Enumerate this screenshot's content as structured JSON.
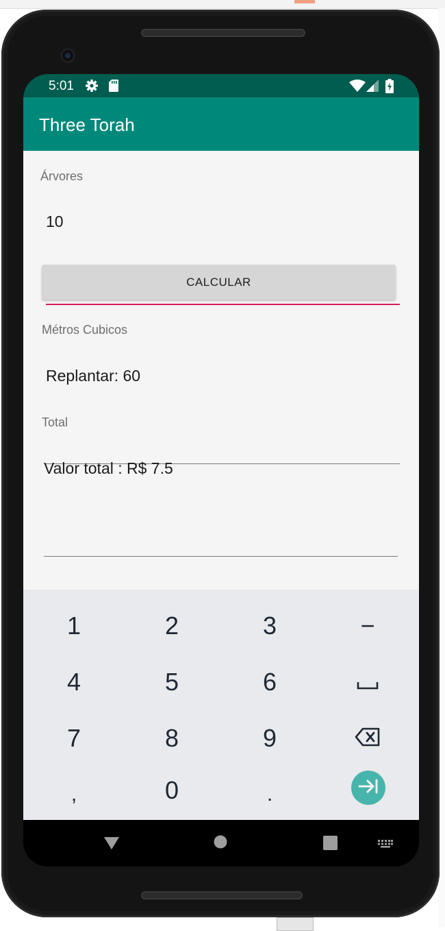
{
  "status_bar": {
    "time": "5:01",
    "icons": [
      "settings-icon",
      "sd-card-icon",
      "wifi-icon",
      "signal-icon",
      "battery-charging-icon"
    ]
  },
  "app": {
    "title": "Three Torah",
    "accent_color": "#00897b",
    "status_color": "#005d4f",
    "focus_color": "#d81b60"
  },
  "form": {
    "arvores_label": "Árvores",
    "arvores_value": "10",
    "calc_button": "CALCULAR",
    "metros_label": "Métros Cubicos",
    "metros_value": "Replantar: 60",
    "total_label": "Total",
    "total_value": "Valor total : R$ 7.5"
  },
  "keyboard": {
    "keys": [
      "1",
      "2",
      "3",
      "−",
      "4",
      "5",
      "6",
      "␣",
      "7",
      "8",
      "9",
      "⌫",
      ",",
      "0",
      ".",
      "⇥"
    ],
    "k1": "1",
    "k2": "2",
    "k3": "3",
    "k_minus": "−",
    "k4": "4",
    "k5": "5",
    "k6": "6",
    "k7": "7",
    "k8": "8",
    "k9": "9",
    "k_comma": ",",
    "k0": "0",
    "k_period": ".",
    "space_icon": "space-icon",
    "backspace_icon": "backspace-icon",
    "enter_icon": "next-field-icon"
  },
  "navigation": {
    "icons": [
      "back-icon",
      "home-icon",
      "recents-icon",
      "keyboard-switch-icon"
    ]
  }
}
